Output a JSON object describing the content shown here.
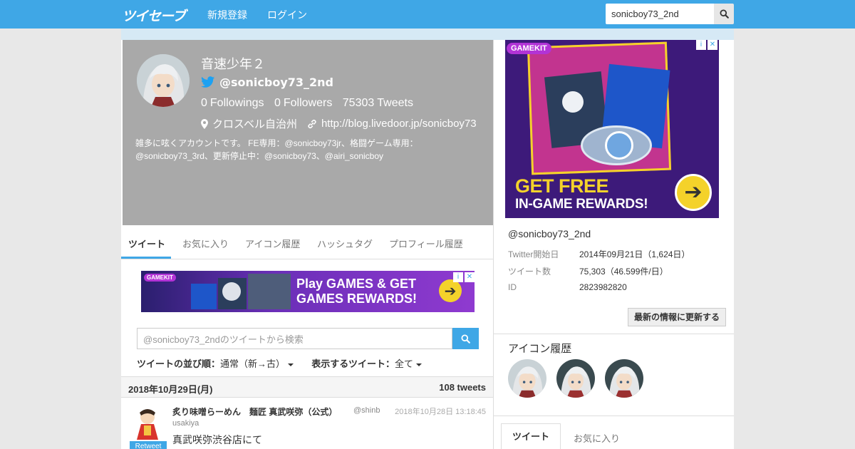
{
  "nav": {
    "logo": "ツイセーブ",
    "register": "新規登録",
    "login": "ログイン",
    "search_value": "sonicboy73_2nd"
  },
  "profile": {
    "name": "音速少年２",
    "screen_name": "@sonicboy73_2nd",
    "followings_count": "0",
    "followings_label": "Followings",
    "followers_count": "0",
    "followers_label": "Followers",
    "tweets_count": "75303",
    "tweets_label": "Tweets",
    "location": "クロスベル自治州",
    "url": "http://blog.livedoor.jp/sonicboy73",
    "bio": "雑多に呟くアカウントです。 FE専用：@sonicboy73jr、格闘ゲーム専用：@sonicboy73_3rd、更新停止中：@sonicboy73、@airi_sonicboy"
  },
  "tabs": [
    "ツイート",
    "お気に入り",
    "アイコン履歴",
    "ハッシュタグ",
    "プロフィール履歴"
  ],
  "ad_banner": {
    "brand": "GAMEKIT",
    "line1": "Play GAMES & GET",
    "line2": "GAMES REWARDS!"
  },
  "tweet_search": {
    "placeholder": "@sonicboy73_2ndのツイートから検索"
  },
  "sort": {
    "order_label": "ツイートの並び順：",
    "order_value": "通常（新→古）",
    "filter_label": "表示するツイート：",
    "filter_value": "全て"
  },
  "date_bar": {
    "date": "2018年10月29日(月)",
    "count": "108 tweets"
  },
  "tweet": {
    "name": "炙り味噌らーめん　麺匠 真武咲弥（公式）",
    "handle": "@shinb",
    "handle_cont": "usakiya",
    "time": "2018年10月28日 13:18:45",
    "badge": "Retweet",
    "text_line1": "真武咲弥渋谷店にて"
  },
  "side_ad": {
    "brand": "GAMEKIT",
    "big": "GET FREE",
    "small": "IN-GAME REWARDS!"
  },
  "info": {
    "handle": "@sonicboy73_2nd",
    "rows": [
      {
        "k": "Twitter開始日",
        "v": "2014年09月21日（1,624日）"
      },
      {
        "k": "ツイート数",
        "v": "75,303（46.599件/日）"
      },
      {
        "k": "ID",
        "v": "2823982820"
      }
    ],
    "update_button": "最新の情報に更新する"
  },
  "icon_history": {
    "title": "アイコン履歴"
  },
  "sub_tabs": [
    "ツイート",
    "お気に入り"
  ],
  "colors": {
    "accent": "#3fa7e6",
    "header_bg": "#a9a9a9"
  }
}
